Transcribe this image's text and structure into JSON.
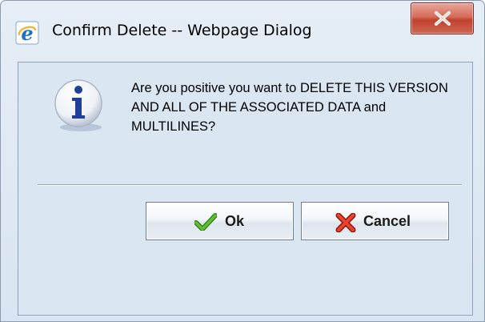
{
  "window": {
    "title": "Confirm Delete -- Webpage Dialog",
    "title_icon": "internet-explorer-icon",
    "close_icon": "close-icon"
  },
  "dialog": {
    "icon": "info-icon",
    "message": "Are you positive you want to DELETE THIS VERSION AND ALL OF THE ASSOCIATED DATA and MULTILINES?"
  },
  "buttons": {
    "ok_label": "Ok",
    "ok_icon": "checkmark-icon",
    "cancel_label": "Cancel",
    "cancel_icon": "red-x-icon"
  },
  "colors": {
    "dialog_background": "#dbe6f3",
    "close_button": "#c0432e",
    "check_green": "#3f9a1f",
    "cancel_red": "#d02c1c",
    "info_blue": "#1f3f9b"
  }
}
